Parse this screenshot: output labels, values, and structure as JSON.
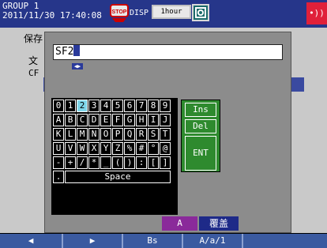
{
  "header": {
    "group": "GROUP 1",
    "datetime": "2011/11/30 17:40:08",
    "stop_icon": "stop-icon",
    "disp": "DISP",
    "timebase": "1hour",
    "alarm_icon": "alarm-icon"
  },
  "background": {
    "label1": "保存",
    "label2": "文",
    "label3": "CF"
  },
  "dialog": {
    "input_value": "SF2",
    "keyboard_rows": [
      [
        "0",
        "1",
        "2",
        "3",
        "4",
        "5",
        "6",
        "7",
        "8",
        "9"
      ],
      [
        "A",
        "B",
        "C",
        "D",
        "E",
        "F",
        "G",
        "H",
        "I",
        "J"
      ],
      [
        "K",
        "L",
        "M",
        "N",
        "O",
        "P",
        "Q",
        "R",
        "S",
        "T"
      ],
      [
        "U",
        "V",
        "W",
        "X",
        "Y",
        "Z",
        "%",
        "#",
        "°",
        "@"
      ],
      [
        "-",
        "+",
        "/",
        "*",
        "_",
        "(",
        ")",
        ":",
        "[",
        "]"
      ]
    ],
    "selected_key": "2",
    "key_dot": ".",
    "key_space": "Space",
    "func_keys": [
      "Ins",
      "Del",
      "ENT"
    ],
    "mode_charset": "A",
    "mode_overwrite": "覆盖"
  },
  "softkeys": [
    "◀",
    "▶",
    "Bs",
    "A/a/1"
  ],
  "colors": {
    "header_bg": "#26368a",
    "dialog_bg": "#8c8c8c",
    "func_bg": "#2e8a2e",
    "selected_key": "#7fd6ea"
  }
}
